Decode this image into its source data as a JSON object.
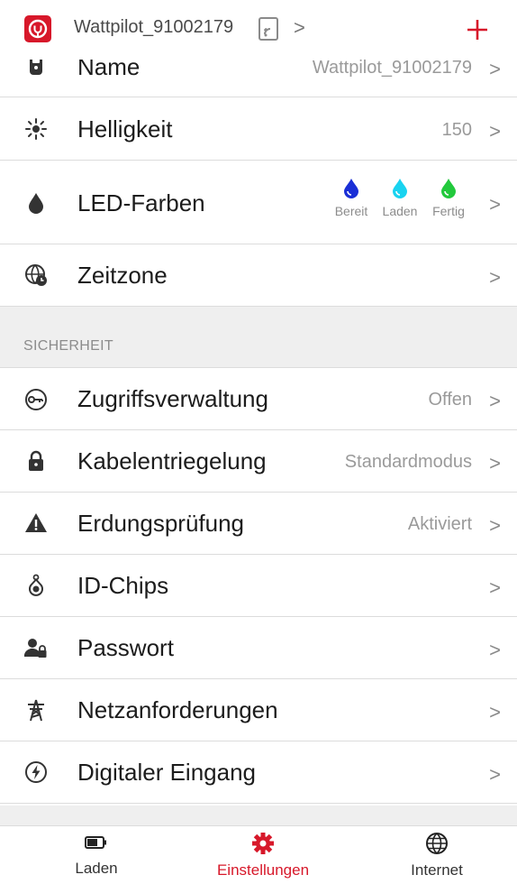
{
  "header": {
    "device_title": "Wattpilot_91002179",
    "title_chevron": ">",
    "add_label": "+"
  },
  "settings": {
    "name": {
      "label": "Name",
      "value": "Wattpilot_91002179",
      "icon": "device-icon"
    },
    "brightness": {
      "label": "Helligkeit",
      "value": "150",
      "icon": "sun-icon"
    },
    "led_colors": {
      "label": "LED-Farben",
      "icon": "droplet-icon",
      "items": [
        {
          "caption": "Bereit",
          "color": "#1a2fd6"
        },
        {
          "caption": "Laden",
          "color": "#19d3f0"
        },
        {
          "caption": "Fertig",
          "color": "#22c93c"
        }
      ]
    },
    "timezone": {
      "label": "Zeitzone",
      "icon": "globe-clock-icon"
    }
  },
  "security": {
    "section_title": "SICHERHEIT",
    "items": [
      {
        "label": "Zugriffsverwaltung",
        "value": "Offen",
        "icon": "key-icon"
      },
      {
        "label": "Kabelentriegelung",
        "value": "Standardmodus",
        "icon": "lock-icon"
      },
      {
        "label": "Erdungsprüfung",
        "value": "Aktiviert",
        "icon": "warning-icon"
      },
      {
        "label": "ID-Chips",
        "value": "",
        "icon": "id-chip-icon"
      },
      {
        "label": "Passwort",
        "value": "",
        "icon": "user-lock-icon"
      },
      {
        "label": "Netzanforderungen",
        "value": "",
        "icon": "power-pylon-icon"
      },
      {
        "label": "Digitaler Eingang",
        "value": "",
        "icon": "lightning-circle-icon"
      }
    ]
  },
  "chevron": ">",
  "tabs": [
    {
      "label": "Laden",
      "icon": "battery-icon",
      "active": false
    },
    {
      "label": "Einstellungen",
      "icon": "gear-icon",
      "active": true
    },
    {
      "label": "Internet",
      "icon": "globe-icon",
      "active": false
    }
  ],
  "colors": {
    "accent": "#d7182a",
    "muted_text": "#9a9a9a",
    "section_bg": "#efefef"
  }
}
